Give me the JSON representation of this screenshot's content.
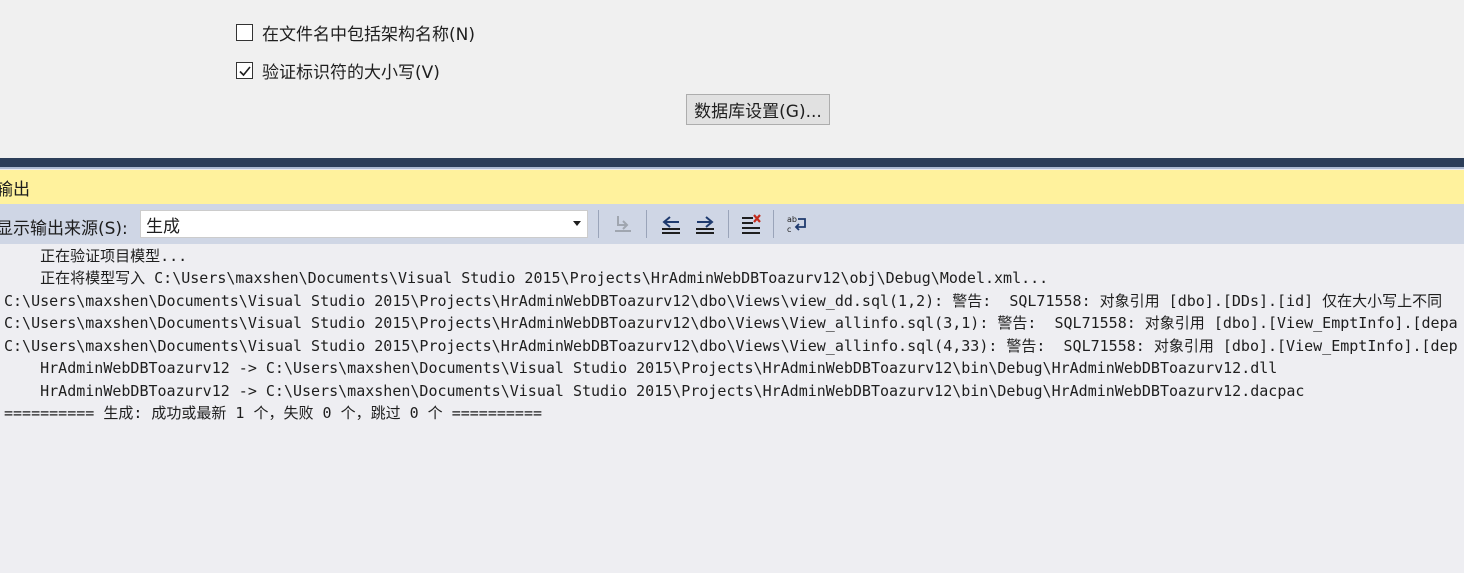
{
  "settings": {
    "checkbox_schema": {
      "label": "在文件名中包括架构名称(N)",
      "checked": false
    },
    "checkbox_case": {
      "label": "验证标识符的大小写(V)",
      "checked": true
    },
    "db_settings_button": "数据库设置(G)..."
  },
  "output_panel": {
    "title": "输出",
    "source_label": "显示输出来源(S):",
    "source_value": "生成",
    "toolbar_icons": [
      "go-to-build-error-icon",
      "previous-message-icon",
      "next-message-icon",
      "clear-all-icon",
      "word-wrap-icon"
    ],
    "lines": [
      "    正在验证项目模型...",
      "    正在将模型写入 C:\\Users\\maxshen\\Documents\\Visual Studio 2015\\Projects\\HrAdminWebDBToazurv12\\obj\\Debug\\Model.xml...",
      "C:\\Users\\maxshen\\Documents\\Visual Studio 2015\\Projects\\HrAdminWebDBToazurv12\\dbo\\Views\\view_dd.sql(1,2): 警告:  SQL71558: 对象引用 [dbo].[DDs].[id] 仅在大小写上不同",
      "C:\\Users\\maxshen\\Documents\\Visual Studio 2015\\Projects\\HrAdminWebDBToazurv12\\dbo\\Views\\View_allinfo.sql(3,1): 警告:  SQL71558: 对象引用 [dbo].[View_EmptInfo].[depa",
      "C:\\Users\\maxshen\\Documents\\Visual Studio 2015\\Projects\\HrAdminWebDBToazurv12\\dbo\\Views\\View_allinfo.sql(4,33): 警告:  SQL71558: 对象引用 [dbo].[View_EmptInfo].[dep",
      "    HrAdminWebDBToazurv12 -> C:\\Users\\maxshen\\Documents\\Visual Studio 2015\\Projects\\HrAdminWebDBToazurv12\\bin\\Debug\\HrAdminWebDBToazurv12.dll",
      "    HrAdminWebDBToazurv12 -> C:\\Users\\maxshen\\Documents\\Visual Studio 2015\\Projects\\HrAdminWebDBToazurv12\\bin\\Debug\\HrAdminWebDBToazurv12.dacpac",
      "========== 生成: 成功或最新 1 个，失败 0 个，跳过 0 个 =========="
    ]
  },
  "colors": {
    "panel_title_bg": "#fff29d",
    "toolbar_bg": "#cfd6e5",
    "splitter": "#2c3e59",
    "output_bg": "#eeeef2"
  }
}
